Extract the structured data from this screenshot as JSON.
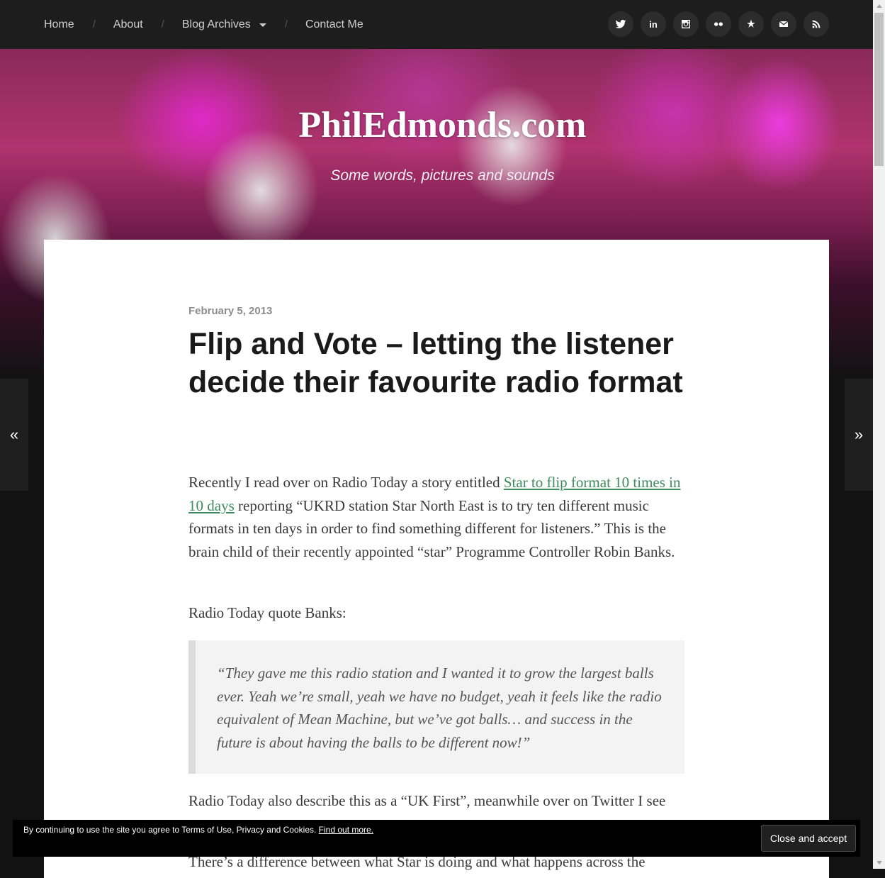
{
  "nav": {
    "items": [
      {
        "label": "Home"
      },
      {
        "label": "About"
      },
      {
        "label": "Blog Archives"
      },
      {
        "label": "Contact Me"
      }
    ],
    "separator": "/"
  },
  "social": [
    {
      "icon": "twitter-icon"
    },
    {
      "icon": "linkedin-icon",
      "glyph": "in"
    },
    {
      "icon": "instagram-icon"
    },
    {
      "icon": "flickr-icon"
    },
    {
      "icon": "star-icon",
      "glyph": "★"
    },
    {
      "icon": "mail-icon"
    },
    {
      "icon": "rss-icon"
    }
  ],
  "site": {
    "title": "PhilEdmonds.com",
    "tagline": "Some words, pictures and sounds"
  },
  "post": {
    "date": "February 5, 2013",
    "title": "Flip and Vote – letting the listener decide their favourite radio format",
    "p1_before": "Recently I read over on Radio Today a story entitled ",
    "p1_link": "Star to flip format 10 times in 10 days",
    "p1_after": " reporting “UKRD station Star North East is to try ten different music formats in ten days in order to find something different for listeners.” This is the brain child of their recently appointed “star” Programme Controller Robin Banks.",
    "p2": "Radio Today quote Banks:",
    "quote": "“They gave me this radio station and I wanted it to grow the largest balls ever. Yeah we’re small, yeah we have no budget, yeah it feels like the radio equivalent of Mean Machine, but we’ve got balls… and success in the future is about having the balls to be different now!”",
    "p3": "Radio Today also describe this as a “UK First”, meanwhile over on Twitter I see",
    "p4": "There’s a difference between what Star is doing and what happens across the"
  },
  "arrows": {
    "prev": "«",
    "next": "»"
  },
  "cookie": {
    "text": "By continuing to use the site you agree to Terms of Use, Privacy and Cookies. ",
    "link": "Find out more.",
    "button": "Close and accept"
  },
  "colors": {
    "nav_bg": "#1d1d1d",
    "link": "#3f8a5f",
    "page_bg": "#121212"
  }
}
